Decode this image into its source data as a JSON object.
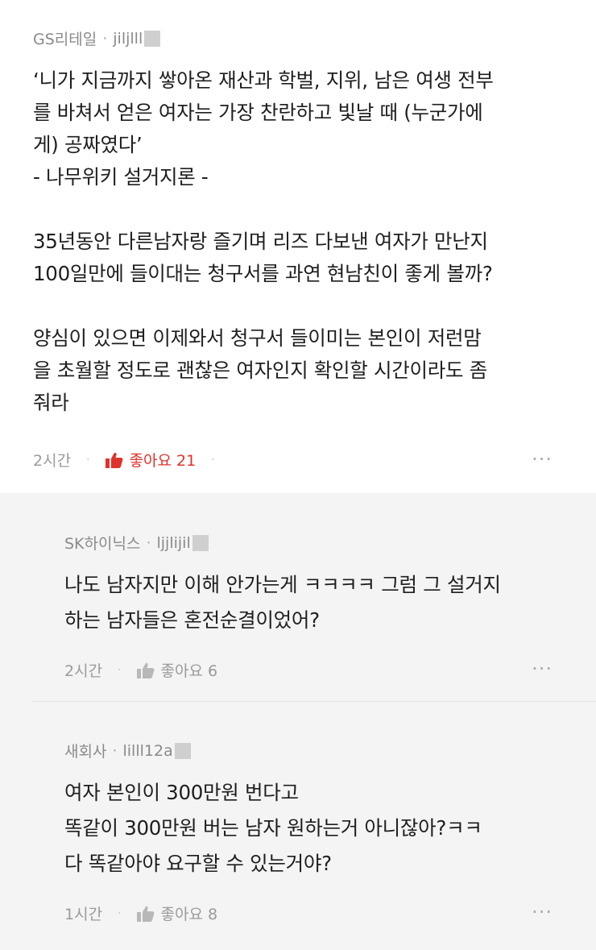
{
  "comment": {
    "company": "GS리테일",
    "separator": "·",
    "username": "jiljlll",
    "lines": [
      [
        "‘니가 지금까지 쌓아온 재산과 학벌, 지위, 남은 여생 전부",
        "를 바쳐서 얻은 여자는 가장 찬란하고 빛날 때 (누군가에",
        "게) 공짜였다’",
        "- 나무위키 설거지론 -"
      ],
      [
        "35년동안 다른남자랑 즐기며 리즈 다보낸 여자가 만난지",
        "100일만에 들이대는 청구서를 과연 현남친이 좋게 볼까?"
      ],
      [
        "양심이 있으면 이제와서 청구서 들이미는 본인이 저런맘",
        "을 초월할 정도로 괜찮은 여자인지 확인할 시간이라도 좀",
        "줘라"
      ]
    ],
    "time": "2시간",
    "like_label": "좋아요 21",
    "like_icon": "thumbs-up-icon",
    "more": "···",
    "like_color": "#e0322d"
  },
  "replies": [
    {
      "company": "SK하이닉스",
      "separator": "·",
      "username": "ljjlijil",
      "lines": [
        "나도 남자지만 이해 안가는게 ㅋㅋㅋㅋ 그럼 그 설거지",
        "하는 남자들은 혼전순결이었어?"
      ],
      "time": "2시간",
      "like_label": "좋아요 6",
      "more": "···"
    },
    {
      "company": "새회사",
      "separator": "·",
      "username": "lilll12a",
      "lines": [
        "여자 본인이 300만원 번다고",
        "똑같이 300만원 버는 남자 원하는거 아니잖아?ㅋㅋ",
        "다 똑같아야 요구할 수 있는거야?"
      ],
      "time": "1시간",
      "like_label": "좋아요 8",
      "more": "···"
    }
  ]
}
